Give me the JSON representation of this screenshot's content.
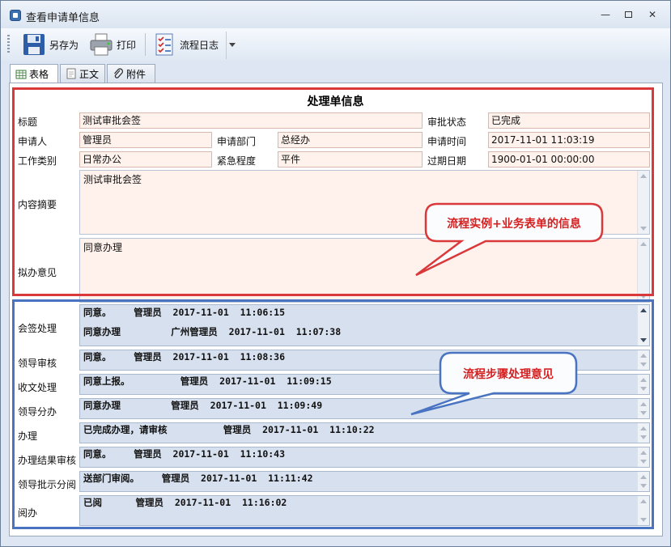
{
  "window": {
    "title": "查看申请单信息",
    "min": "—",
    "restore": "▫",
    "close": "✕"
  },
  "toolbar": {
    "save_as": "另存为",
    "print": "打印",
    "flow_log": "流程日志"
  },
  "tabs": [
    {
      "label": "表格"
    },
    {
      "label": "正文"
    },
    {
      "label": "附件"
    }
  ],
  "form": {
    "title": "处理单信息",
    "labels": {
      "subject": "标题",
      "status": "审批状态",
      "applicant": "申请人",
      "dept": "申请部门",
      "apply_time": "申请时间",
      "work_type": "工作类别",
      "urgency": "紧急程度",
      "expire": "过期日期",
      "summary": "内容摘要",
      "opinion": "拟办意见"
    },
    "values": {
      "subject": "测试审批会签",
      "status": "已完成",
      "applicant": "管理员",
      "dept": "总经办",
      "apply_time": "2017-11-01 11:03:19",
      "work_type": "日常办公",
      "urgency": "平件",
      "expire": "1900-01-01 00:00:00",
      "summary": "测试审批会签",
      "opinion": "同意办理"
    }
  },
  "steps": [
    {
      "label": "会签处理",
      "lines": [
        "同意。    管理员  2017-11-01  11:06:15",
        "同意办理         广州管理员  2017-11-01  11:07:38"
      ]
    },
    {
      "label": "领导审核",
      "lines": [
        "同意。    管理员  2017-11-01  11:08:36"
      ]
    },
    {
      "label": "收文处理",
      "lines": [
        "同意上报。         管理员  2017-11-01  11:09:15"
      ]
    },
    {
      "label": "领导分办",
      "lines": [
        "同意办理         管理员  2017-11-01  11:09:49"
      ]
    },
    {
      "label": "办理",
      "lines": [
        "已完成办理，请审核          管理员  2017-11-01  11:10:22"
      ]
    },
    {
      "label": "办理结果审核",
      "lines": [
        "同意。    管理员  2017-11-01  11:10:43"
      ]
    },
    {
      "label": "领导批示分阅",
      "lines": [
        "送部门审阅。    管理员  2017-11-01  11:11:42"
      ]
    },
    {
      "label": "阅办",
      "lines": [
        "已阅      管理员  2017-11-01  11:16:02"
      ]
    }
  ],
  "callouts": {
    "form_info": "流程实例+业务表单的信息",
    "step_opinions": "流程步骤处理意见"
  },
  "colors": {
    "red_frame": "#d9393a",
    "blue_frame": "#4a74c2",
    "field_bg": "#fff2ec"
  }
}
